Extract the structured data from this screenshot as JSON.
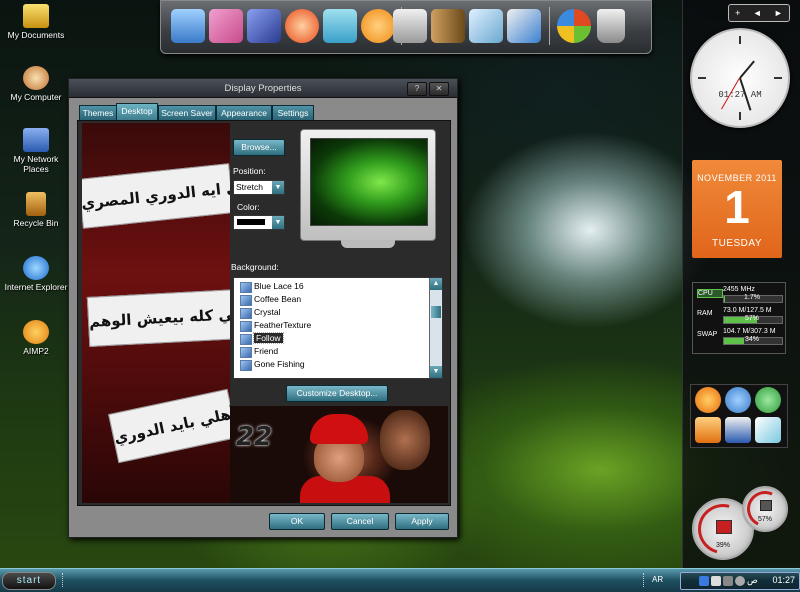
{
  "desktop": {
    "icons": [
      {
        "label": "My Documents",
        "color": "#e8c030"
      },
      {
        "label": "My Computer",
        "color": "#f0d090"
      },
      {
        "label": "My Network Places",
        "color": "#5a8ad0"
      },
      {
        "label": "Recycle Bin",
        "color": "#e0a030"
      },
      {
        "label": "Internet Explorer",
        "color": "#3a90e0"
      },
      {
        "label": "AIMP2",
        "color": "#f0a020"
      }
    ]
  },
  "dock": {
    "items": [
      {
        "name": "monitor-icon",
        "color": "#3a7ac8"
      },
      {
        "name": "paint-icon",
        "color": "#c84a8a"
      },
      {
        "name": "book-icon",
        "color": "#3a5ab8"
      },
      {
        "name": "internet-explorer-icon",
        "color": "#e84a1a"
      },
      {
        "name": "display-icon",
        "color": "#3aa0c8"
      },
      {
        "name": "media-player-icon",
        "color": "#f08a10"
      },
      {
        "name": "calculator-icon",
        "color": "#d0d0d0"
      },
      {
        "name": "pencils-icon",
        "color": "#8a6a3a"
      },
      {
        "name": "notes-icon",
        "color": "#a0c8e0"
      },
      {
        "name": "tools-icon",
        "color": "#3a80d0"
      },
      {
        "name": "windows-icon",
        "color": "#e04a20"
      },
      {
        "name": "recycle-bin-icon",
        "color": "#c0c0c0"
      }
    ]
  },
  "sidebar": {
    "controls": [
      "+",
      "◄",
      "►"
    ],
    "clock": {
      "time": "01:27 AM"
    },
    "calendar": {
      "month": "NOVEMBER 2011",
      "day": "1",
      "weekday": "TUESDAY"
    },
    "meter": {
      "cpu": {
        "label": "CPU",
        "value": "2455 MHz",
        "percent": "1.7%",
        "fraction": 0.017
      },
      "ram": {
        "label": "RAM",
        "value": "73.0 M/127.5 M",
        "percent": "57%",
        "fraction": 0.57
      },
      "swap": {
        "label": "SWAP",
        "value": "104.7 M/307.3 M",
        "percent": "34%",
        "fraction": 0.34
      }
    },
    "apps": [
      {
        "name": "firefox-icon",
        "color": "#e86a10"
      },
      {
        "name": "thunderbird-icon",
        "color": "#3a7ac8"
      },
      {
        "name": "messenger-icon",
        "color": "#3ab040"
      },
      {
        "name": "vlc-icon",
        "color": "#f08a10"
      },
      {
        "name": "word-icon",
        "color": "#2a5ab0"
      },
      {
        "name": "inkscape-icon",
        "color": "#e0e0e0"
      }
    ],
    "gauges": {
      "disk_big": "39%",
      "disk_small": "57%"
    }
  },
  "dialog": {
    "title": "Display Properties",
    "help_btn": "?",
    "close_btn": "✕",
    "tabs": [
      "Themes",
      "Desktop",
      "Screen Saver",
      "Appearance",
      "Settings"
    ],
    "active_tab": "Desktop",
    "browse": "Browse...",
    "position_label": "Position:",
    "position_value": "Stretch",
    "color_label": "Color:",
    "background_label": "Background:",
    "backgrounds": [
      "Blue Lace 16",
      "Coffee Bean",
      "Crystal",
      "FeatherTexture",
      "Follow",
      "Friend",
      "Gone Fishing"
    ],
    "selected_background": "Follow",
    "customize": "Customize Desktop...",
    "ok": "OK",
    "cancel": "Cancel",
    "apply": "Apply",
    "photo_number": "22",
    "banner_text": [
      "يعني ايه الدوري المصري",
      "يعني كله بيعيش الوهم",
      "الأهلي بايد الدوري"
    ]
  },
  "taskbar": {
    "start": "start",
    "language": "AR",
    "time": "01:27",
    "ampm": "ص"
  }
}
